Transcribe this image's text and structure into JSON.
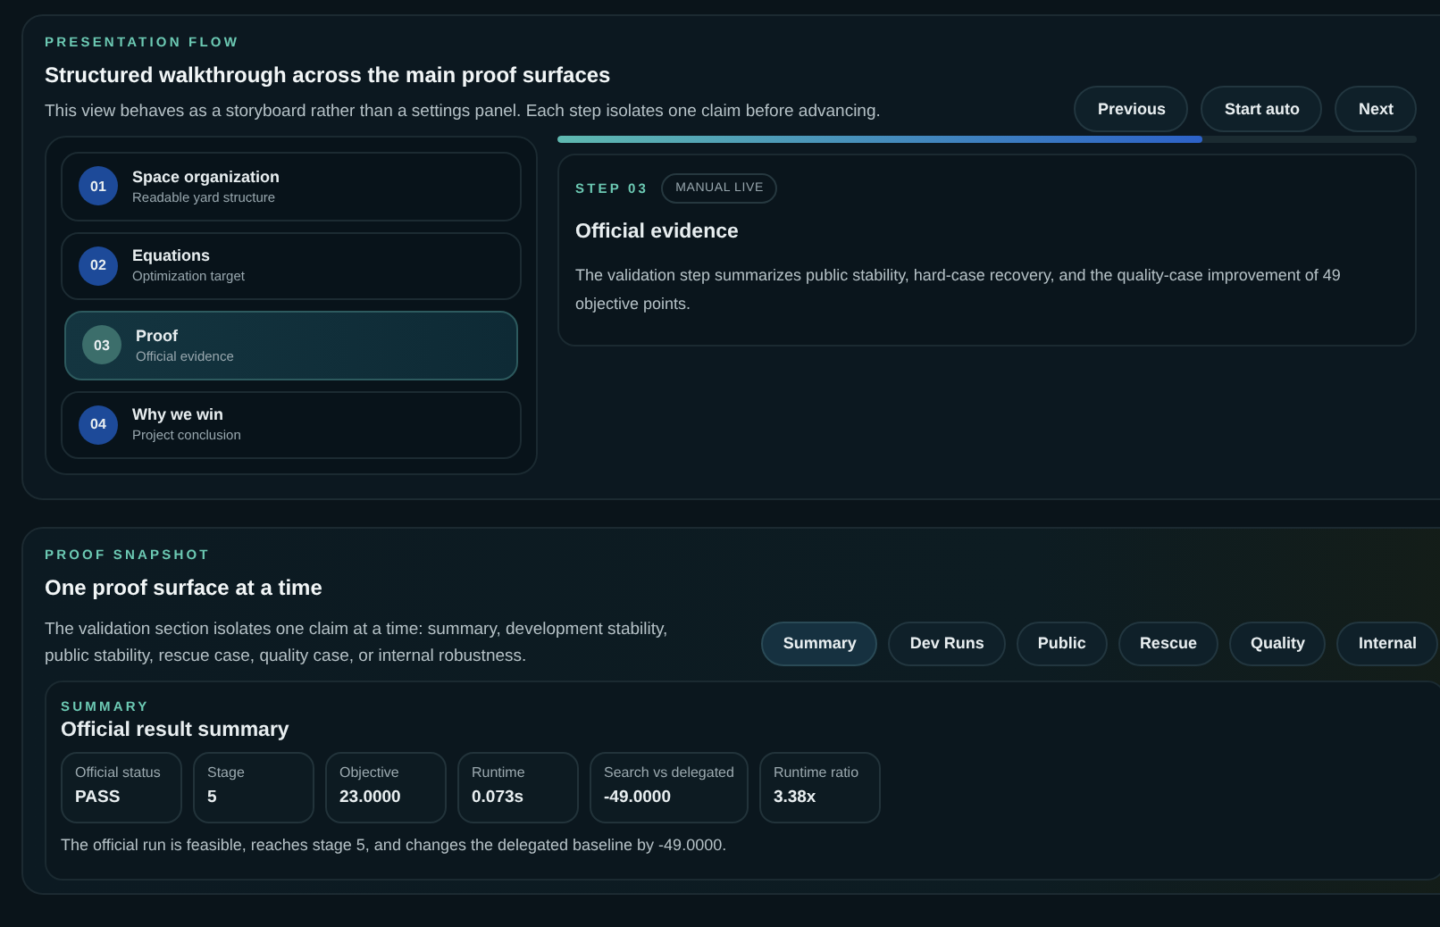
{
  "flow": {
    "eyebrow": "PRESENTATION FLOW",
    "title": "Structured walkthrough across the main proof surfaces",
    "description": "This view behaves as a storyboard rather than a settings panel. Each step isolates one claim before advancing.",
    "buttons": [
      "Previous",
      "Start auto",
      "Next"
    ],
    "progress": {
      "level": 0.75
    },
    "steps": [
      {
        "number": "01",
        "title": "Space organization",
        "subtitle": "Readable yard structure",
        "selected": false
      },
      {
        "number": "02",
        "title": "Equations",
        "subtitle": "Optimization target",
        "selected": false
      },
      {
        "number": "03",
        "title": "Proof",
        "subtitle": "Official evidence",
        "selected": true
      },
      {
        "number": "04",
        "title": "Why we win",
        "subtitle": "Project conclusion",
        "selected": false
      }
    ],
    "detail": {
      "step_label": "STEP 03",
      "badge": "MANUAL LIVE",
      "title": "Official evidence",
      "text": "The validation step summarizes public stability, hard-case recovery, and the quality-case improvement of 49 objective points."
    }
  },
  "snapshot": {
    "eyebrow": "PROOF SNAPSHOT",
    "title": "One proof surface at a time",
    "description": "The validation section isolates one claim at a time: summary, development stability, public stability, rescue case, quality case, or internal robustness.",
    "tabs": [
      {
        "label": "Summary",
        "selected": true
      },
      {
        "label": "Dev Runs",
        "selected": false
      },
      {
        "label": "Public",
        "selected": false
      },
      {
        "label": "Rescue",
        "selected": false
      },
      {
        "label": "Quality",
        "selected": false
      },
      {
        "label": "Internal",
        "selected": false
      }
    ],
    "summary": {
      "eyebrow": "SUMMARY",
      "title": "Official result summary",
      "metrics": [
        {
          "label": "Official status",
          "value": "PASS"
        },
        {
          "label": "Stage",
          "value": "5"
        },
        {
          "label": "Objective",
          "value": "23.0000"
        },
        {
          "label": "Runtime",
          "value": "0.073s"
        },
        {
          "label": "Search vs delegated",
          "value": "-49.0000"
        },
        {
          "label": "Runtime ratio",
          "value": "3.38x"
        }
      ],
      "note": "The official run is feasible, reaches stage 5, and changes the delegated baseline by -49.0000."
    }
  }
}
